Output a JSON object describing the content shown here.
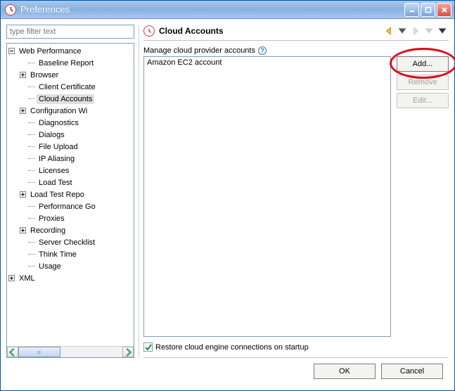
{
  "window": {
    "title": "Preferences"
  },
  "filter": {
    "placeholder": "type filter text"
  },
  "tree": {
    "root_label": "Web Performance",
    "xml_label": "XML",
    "items": [
      {
        "label": "Baseline Report",
        "type": "none"
      },
      {
        "label": "Browser",
        "type": "plus"
      },
      {
        "label": "Client Certificates",
        "type": "none",
        "clip": "Client Certificate"
      },
      {
        "label": "Cloud Accounts",
        "type": "none",
        "selected": true
      },
      {
        "label": "Configuration Wizard",
        "type": "plus",
        "clip": "Configuration Wi"
      },
      {
        "label": "Diagnostics",
        "type": "none"
      },
      {
        "label": "Dialogs",
        "type": "none"
      },
      {
        "label": "File Upload",
        "type": "none"
      },
      {
        "label": "IP Aliasing",
        "type": "none"
      },
      {
        "label": "Licenses",
        "type": "none"
      },
      {
        "label": "Load Test",
        "type": "none"
      },
      {
        "label": "Load Test Reports",
        "type": "plus",
        "clip": "Load Test Repo"
      },
      {
        "label": "Performance Goals",
        "type": "none",
        "clip": "Performance Go"
      },
      {
        "label": "Proxies",
        "type": "none"
      },
      {
        "label": "Recording",
        "type": "plus"
      },
      {
        "label": "Server Checklist",
        "type": "none",
        "clip": "Server Checklist"
      },
      {
        "label": "Think Time",
        "type": "none"
      },
      {
        "label": "Usage",
        "type": "none"
      }
    ]
  },
  "panel": {
    "title": "Cloud Accounts",
    "description": "Manage cloud provider accounts",
    "accounts": [
      {
        "name": "Amazon EC2 account"
      }
    ],
    "buttons": {
      "add": "Add...",
      "remove": "Remove",
      "edit": "Edit..."
    },
    "restore_label": "Restore cloud engine connections on startup",
    "restore_checked": true
  },
  "footer": {
    "ok": "OK",
    "cancel": "Cancel"
  }
}
